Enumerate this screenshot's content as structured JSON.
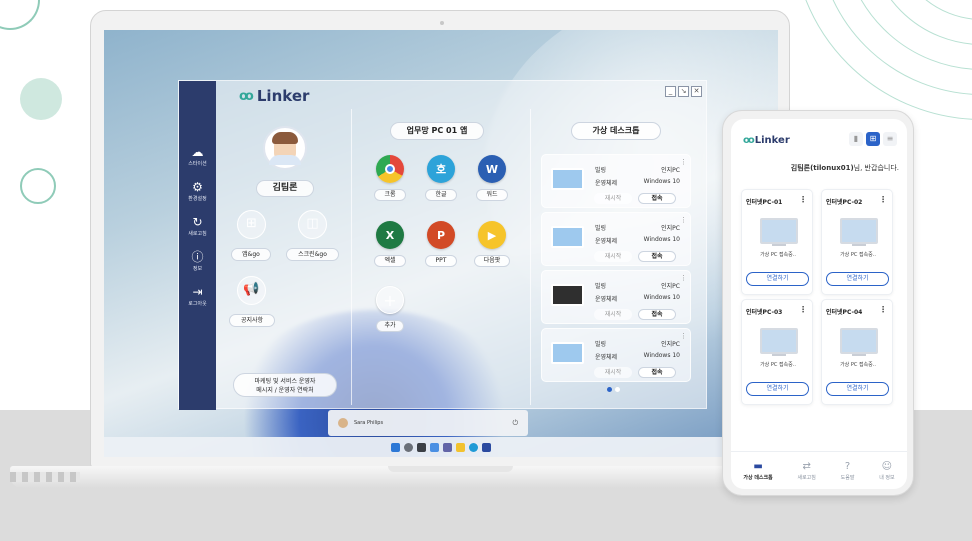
{
  "app": {
    "logo": "Linker",
    "window_controls": [
      "_",
      "↘",
      "✕"
    ],
    "sidebar": [
      {
        "icon": "cloud-icon",
        "label": "스타이션"
      },
      {
        "icon": "gear-icon",
        "label": "환경설정"
      },
      {
        "icon": "refresh-icon",
        "label": "새로고침"
      },
      {
        "icon": "info-icon",
        "label": "정보"
      },
      {
        "icon": "logout-icon",
        "label": "로그아웃"
      }
    ],
    "profile": {
      "name": "김팀론",
      "buttons": [
        {
          "icon": "apps-grid-icon",
          "label": "앱&go"
        },
        {
          "icon": "screen-layout-icon",
          "label": "스크린&go"
        },
        {
          "icon": "megaphone-icon",
          "label": "공지사항"
        }
      ],
      "notice_lines": [
        "마케팅 및 서비스 운영자",
        "메시지 / 운영자 연락처"
      ]
    },
    "apps_panel": {
      "title": "업무망 PC 01 앱",
      "apps": [
        {
          "label": "크롬",
          "glyph": "",
          "color": "#e4483b"
        },
        {
          "label": "한글",
          "glyph": "호",
          "color": "#2da3d9"
        },
        {
          "label": "워드",
          "glyph": "W",
          "color": "#2b5fb3"
        },
        {
          "label": "엑셀",
          "glyph": "X",
          "color": "#1f7a43"
        },
        {
          "label": "PPT",
          "glyph": "P",
          "color": "#d24a26"
        },
        {
          "label": "다음팟",
          "glyph": "▶",
          "color": "#f6c42a"
        },
        {
          "label": "추가",
          "glyph": "+",
          "color": "#ffffff"
        }
      ]
    },
    "vdesk_panel": {
      "title": "가상 데스크톱",
      "cards": [
        {
          "k1": "빌링",
          "v1": "인지PC",
          "k2": "운영체제",
          "v2": "Windows 10",
          "restart": "재시작",
          "connect": "접속",
          "dark": false
        },
        {
          "k1": "빌링",
          "v1": "인지PC",
          "k2": "운영체제",
          "v2": "Windows 10",
          "restart": "재시작",
          "connect": "접속",
          "dark": false
        },
        {
          "k1": "빌링",
          "v1": "인지PC",
          "k2": "운영체제",
          "v2": "Windows 10",
          "restart": "재시작",
          "connect": "접속",
          "dark": true
        },
        {
          "k1": "빌링",
          "v1": "인지PC",
          "k2": "운영체제",
          "v2": "Windows 10",
          "restart": "재시작",
          "connect": "접속",
          "dark": false
        }
      ],
      "page_dots": 2,
      "active_dot": 1
    }
  },
  "startmenu": {
    "user": "Sara Philips"
  },
  "phone": {
    "logo": "Linker",
    "greeting_bold": "김팀론(tilonux01)",
    "greeting_rest": "님, 반갑습니다.",
    "cards": [
      {
        "title": "인터넷PC-01",
        "label": "가상 PC 접속중..",
        "button": "연결하기"
      },
      {
        "title": "인터넷PC-02",
        "label": "가상 PC 접속중..",
        "button": "연결하기"
      },
      {
        "title": "인터넷PC-03",
        "label": "가상 PC 접속중..",
        "button": "연결하기"
      },
      {
        "title": "인터넷PC-04",
        "label": "가상 PC 접속중..",
        "button": "연결하기"
      }
    ],
    "nav": [
      {
        "icon": "monitor-icon",
        "label": "가상 데스크톱",
        "active": true
      },
      {
        "icon": "switch-icon",
        "label": "새로고침",
        "active": false
      },
      {
        "icon": "help-icon",
        "label": "도움말",
        "active": false
      },
      {
        "icon": "profile-icon",
        "label": "내 정보",
        "active": false
      }
    ]
  },
  "colors": {
    "sidebar": "#2c3c6c",
    "accent": "#2b63c8",
    "logo_mark": "#33a79a"
  }
}
